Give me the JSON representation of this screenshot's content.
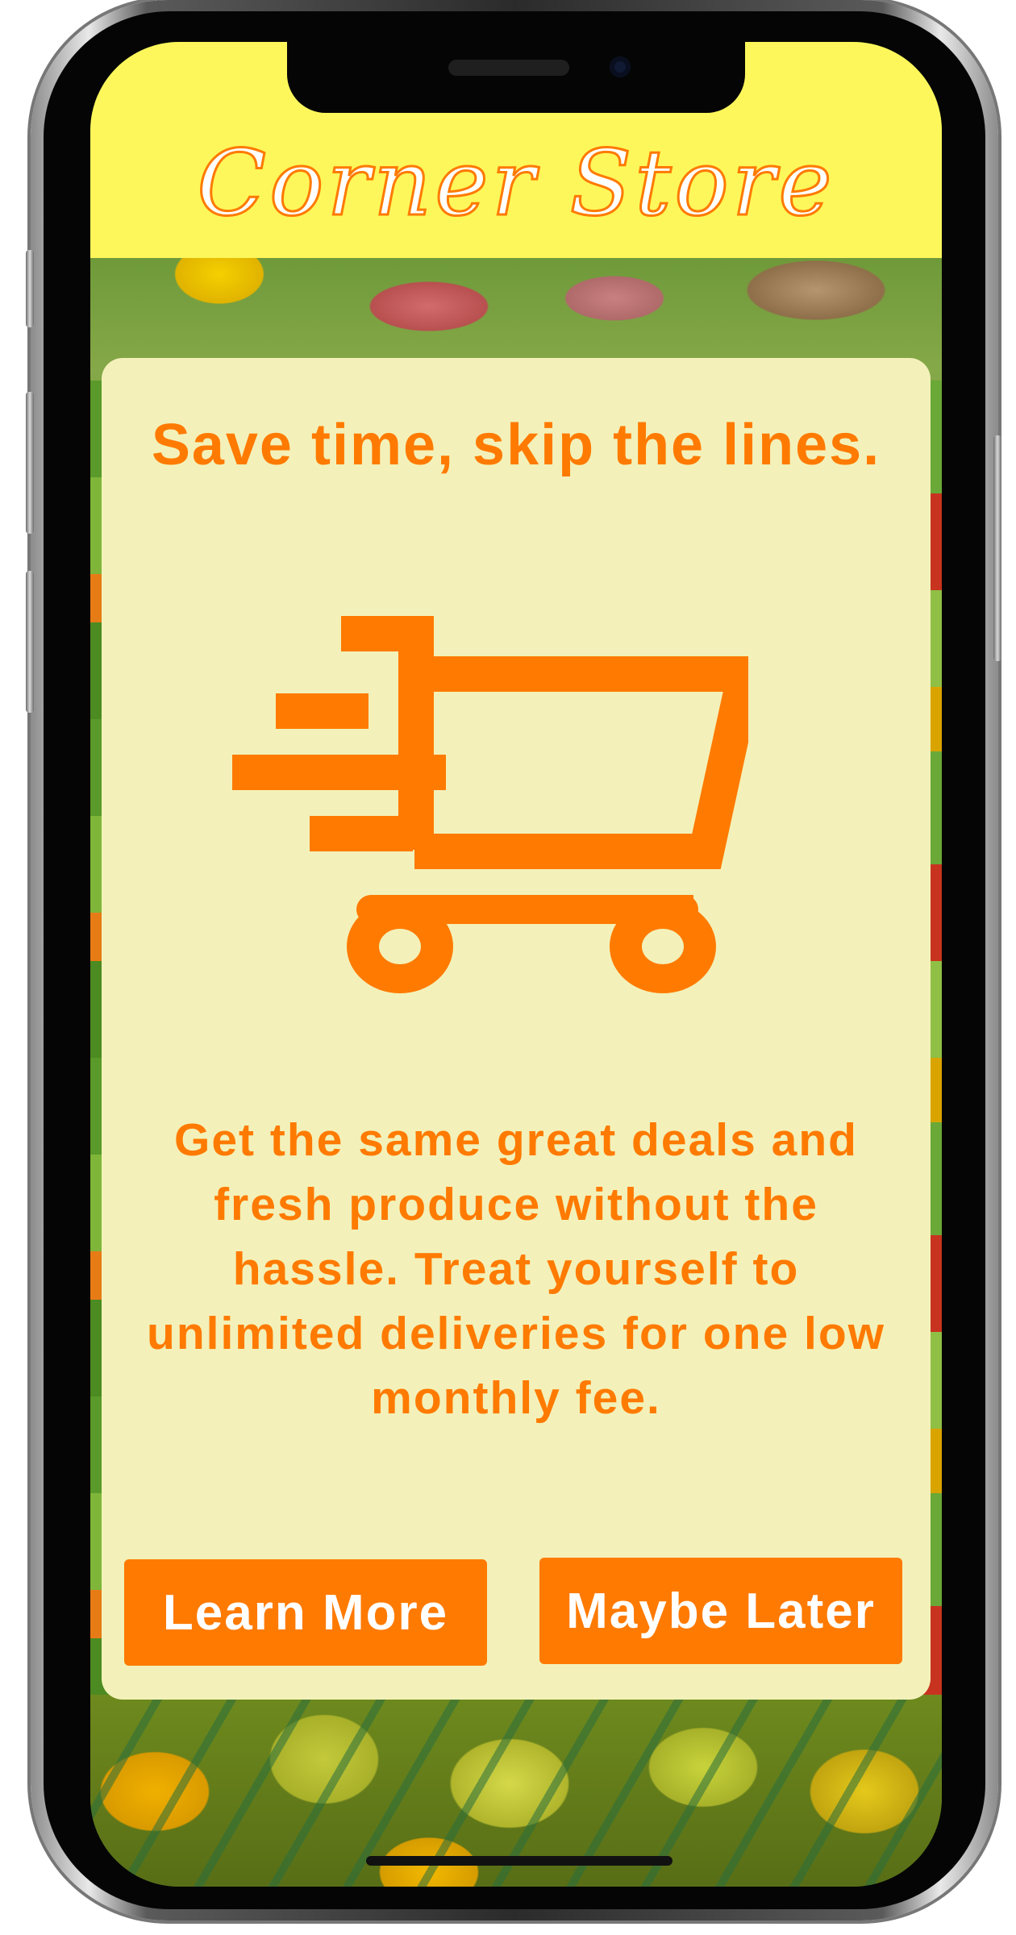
{
  "app": {
    "brand_name": "Corner Store"
  },
  "promo_card": {
    "headline": "Save time, skip the lines.",
    "cart_icon": "fast-shopping-cart-icon",
    "body": "Get the same great deals and fresh produce without the hassle. Treat yourself to unlimited deliveries for one low monthly fee."
  },
  "actions": {
    "learn_more_label": "Learn More",
    "maybe_later_label": "Maybe Later"
  },
  "colors": {
    "accent": "#ff7a00",
    "header_bg": "#fef75b",
    "card_bg": "#f3f1b9",
    "button_text": "#ffffff"
  }
}
